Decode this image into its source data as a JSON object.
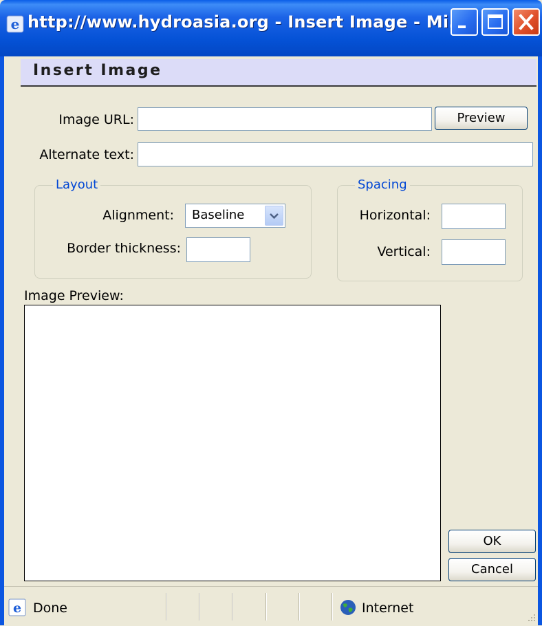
{
  "window": {
    "title": "http://www.hydroasia.org - Insert Image - Mi...",
    "buttons": [
      "minimize",
      "maximize",
      "close"
    ]
  },
  "dialog": {
    "header": "Insert Image",
    "image_url": {
      "label": "Image URL:",
      "value": ""
    },
    "preview_button": "Preview",
    "alt_text": {
      "label": "Alternate text:",
      "value": ""
    },
    "layout": {
      "legend": "Layout",
      "alignment_label": "Alignment:",
      "alignment_value": "Baseline",
      "border_label": "Border thickness:",
      "border_value": ""
    },
    "spacing": {
      "legend": "Spacing",
      "horizontal_label": "Horizontal:",
      "horizontal_value": "",
      "vertical_label": "Vertical:",
      "vertical_value": ""
    },
    "image_preview_label": "Image Preview:",
    "ok_button": "OK",
    "cancel_button": "Cancel"
  },
  "statusbar": {
    "status_text": "Done",
    "zone_text": "Internet",
    "icons": [
      "ie-page-icon",
      "globe-icon"
    ]
  },
  "colors": {
    "titlebar": "#0b56e1",
    "dialog_bg": "#ece9d8",
    "header_bg": "#dcdcf8",
    "legend_text": "#0046d5"
  }
}
